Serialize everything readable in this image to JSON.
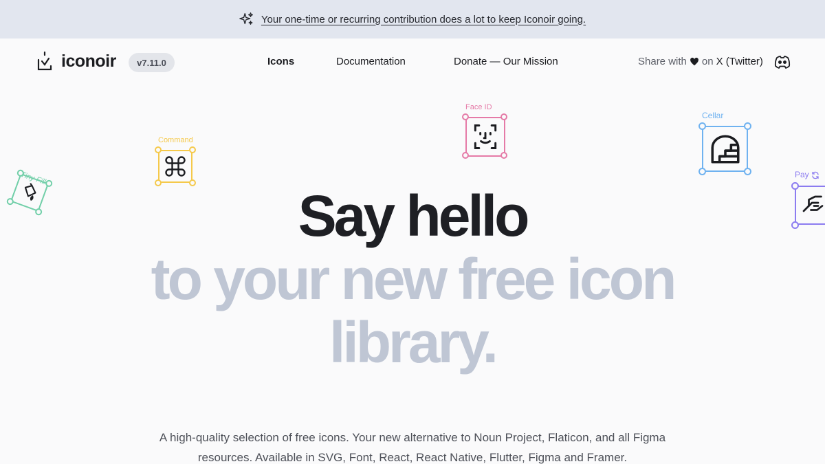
{
  "banner": {
    "text": "Your one-time or recurring contribution does a lot to keep Iconoir going.",
    "icon": "sparks-icon"
  },
  "header": {
    "logo_text": "iconoir",
    "version": "v7.11.0",
    "nav": [
      {
        "label": "Icons",
        "active": true
      },
      {
        "label": "Documentation",
        "active": false
      },
      {
        "label": "Donate — Our Mission",
        "active": false
      }
    ],
    "share_prefix": "Share with",
    "share_middle": "on",
    "share_target": "X (Twitter)",
    "discord_icon": "discord-icon"
  },
  "floating_icons": [
    {
      "label": "Command",
      "icon": "command-icon",
      "color": "#f5c94b"
    },
    {
      "label": "Face ID",
      "icon": "face-id-icon",
      "color": "#e57aa7"
    },
    {
      "label": "Cellar",
      "icon": "cellar-icon",
      "color": "#6fb2f0"
    },
    {
      "label": "Tiny Fill",
      "icon": "fill-icon",
      "color": "#72cfa9"
    },
    {
      "label": "Pay",
      "icon": "pay-icon",
      "color": "#8c7cf0"
    }
  ],
  "hero": {
    "line1": "Say hello",
    "line2": "to your new free icon",
    "line3": "library."
  },
  "description": "A high-quality selection of free icons. Your new alternative to Noun Project, Flaticon, and all Figma resources. Available in SVG, Font, React, React Native, Flutter, Figma and Framer."
}
